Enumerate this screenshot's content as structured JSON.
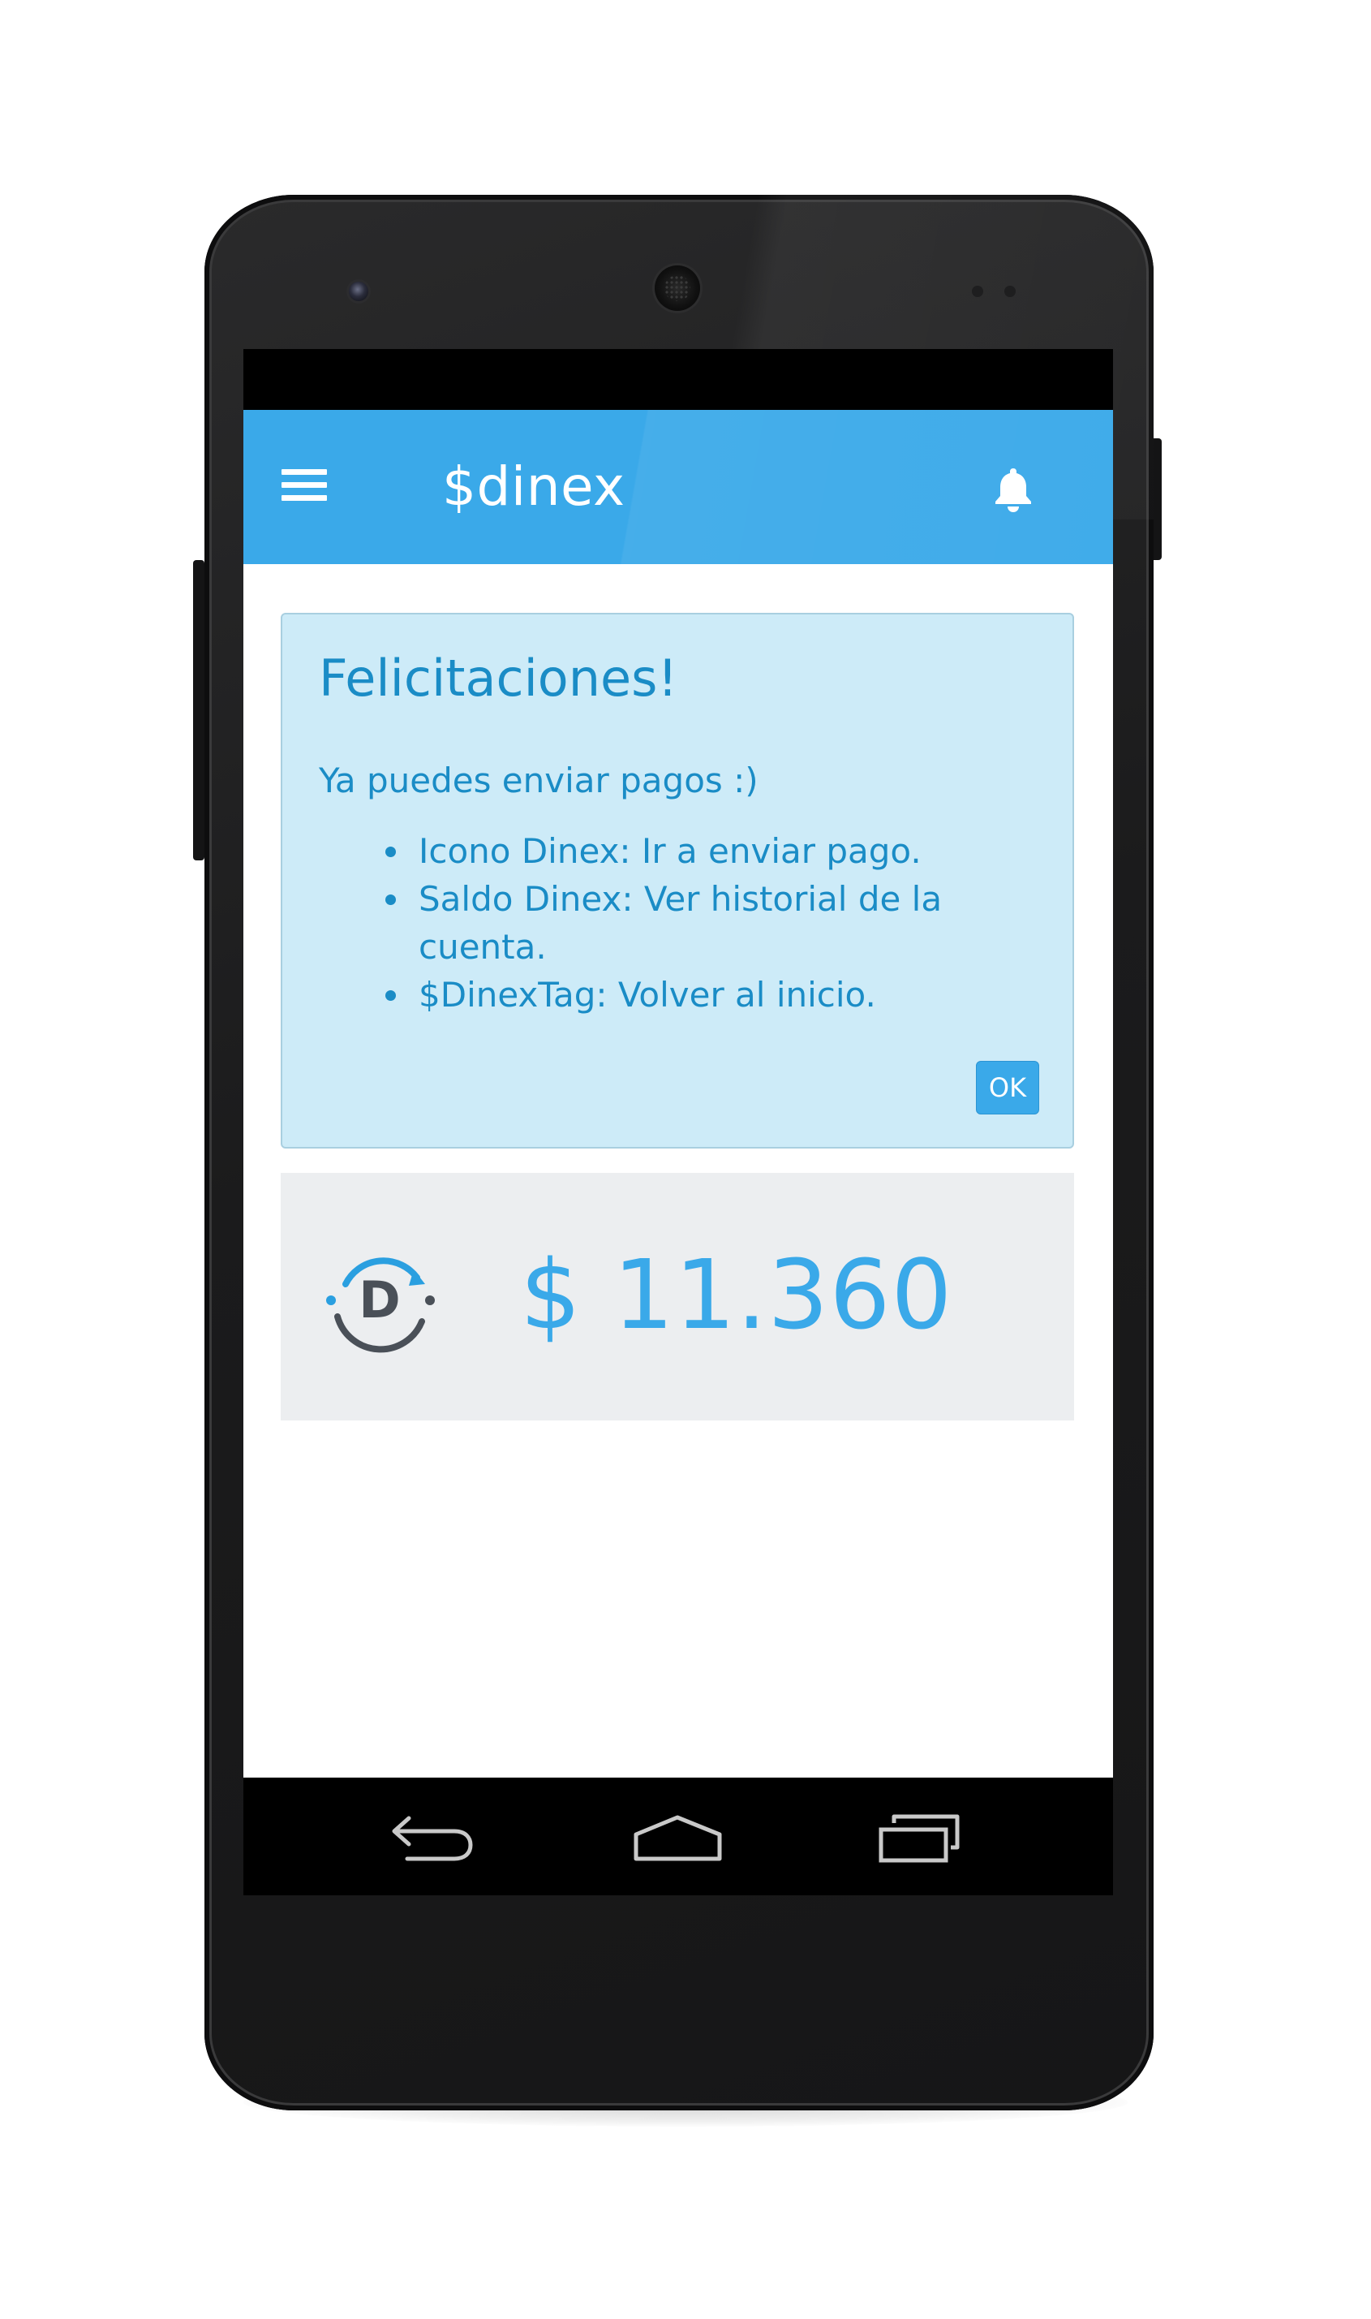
{
  "appbar": {
    "title": "$dinex",
    "menu_icon": "hamburger-menu-icon",
    "notification_icon": "bell-icon",
    "color": "#3aa9e9"
  },
  "alert": {
    "title": "Felicitaciones!",
    "message": "Ya puedes enviar pagos :)",
    "items": [
      "Icono Dinex: Ir a enviar pago.",
      "Saldo Dinex: Ver historial de la cuenta.",
      "$DinexTag: Volver al inicio."
    ],
    "ok_label": "OK",
    "background": "#cdebf8",
    "text_color": "#1a8cc6"
  },
  "balance": {
    "logo_letter": "D",
    "logo_icon": "dinex-logo-icon",
    "amount": "$ 11.360",
    "background": "#eceef0",
    "amount_color": "#3aa9e9"
  },
  "navbar": {
    "back_icon": "back-arrow-icon",
    "home_icon": "home-icon",
    "recent_icon": "recent-apps-icon"
  }
}
